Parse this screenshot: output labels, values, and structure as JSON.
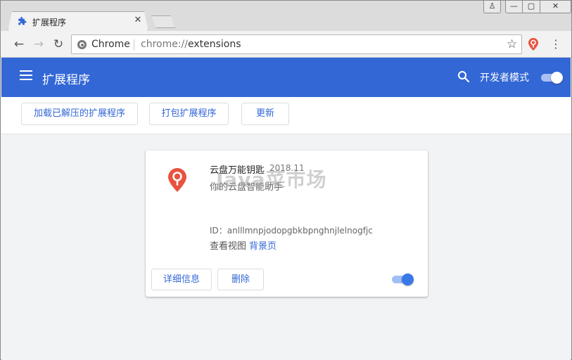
{
  "window": {
    "tab_title": "扩展程序",
    "tab_close": "✕",
    "controls": {
      "user": "♙",
      "minimize": "—",
      "maximize": "▢",
      "close": "✕"
    }
  },
  "toolbar": {
    "site_label": "Chrome",
    "url_scheme": "chrome://",
    "url_path": "extensions",
    "back": "←",
    "forward": "→",
    "reload": "↻",
    "star": "☆",
    "menu": "⋮"
  },
  "header": {
    "title": "扩展程序",
    "dev_mode_label": "开发者模式",
    "dev_mode_on": true,
    "accent_color": "#3367d6"
  },
  "actions": {
    "load_unpacked": "加载已解压的扩展程序",
    "pack": "打包扩展程序",
    "update": "更新"
  },
  "extension": {
    "name": "云盘万能钥匙",
    "version": "2018.11",
    "description": "你的云盘智能助手",
    "id_line": "ID：anlllmnpjodopgbkbpnghnjlelnogfjc",
    "views_label": "查看视图",
    "views_link": "背景页",
    "details_button": "详细信息",
    "remove_button": "删除",
    "enabled": true,
    "icon_color": "#e8533f"
  },
  "watermark": "Java菜市场"
}
